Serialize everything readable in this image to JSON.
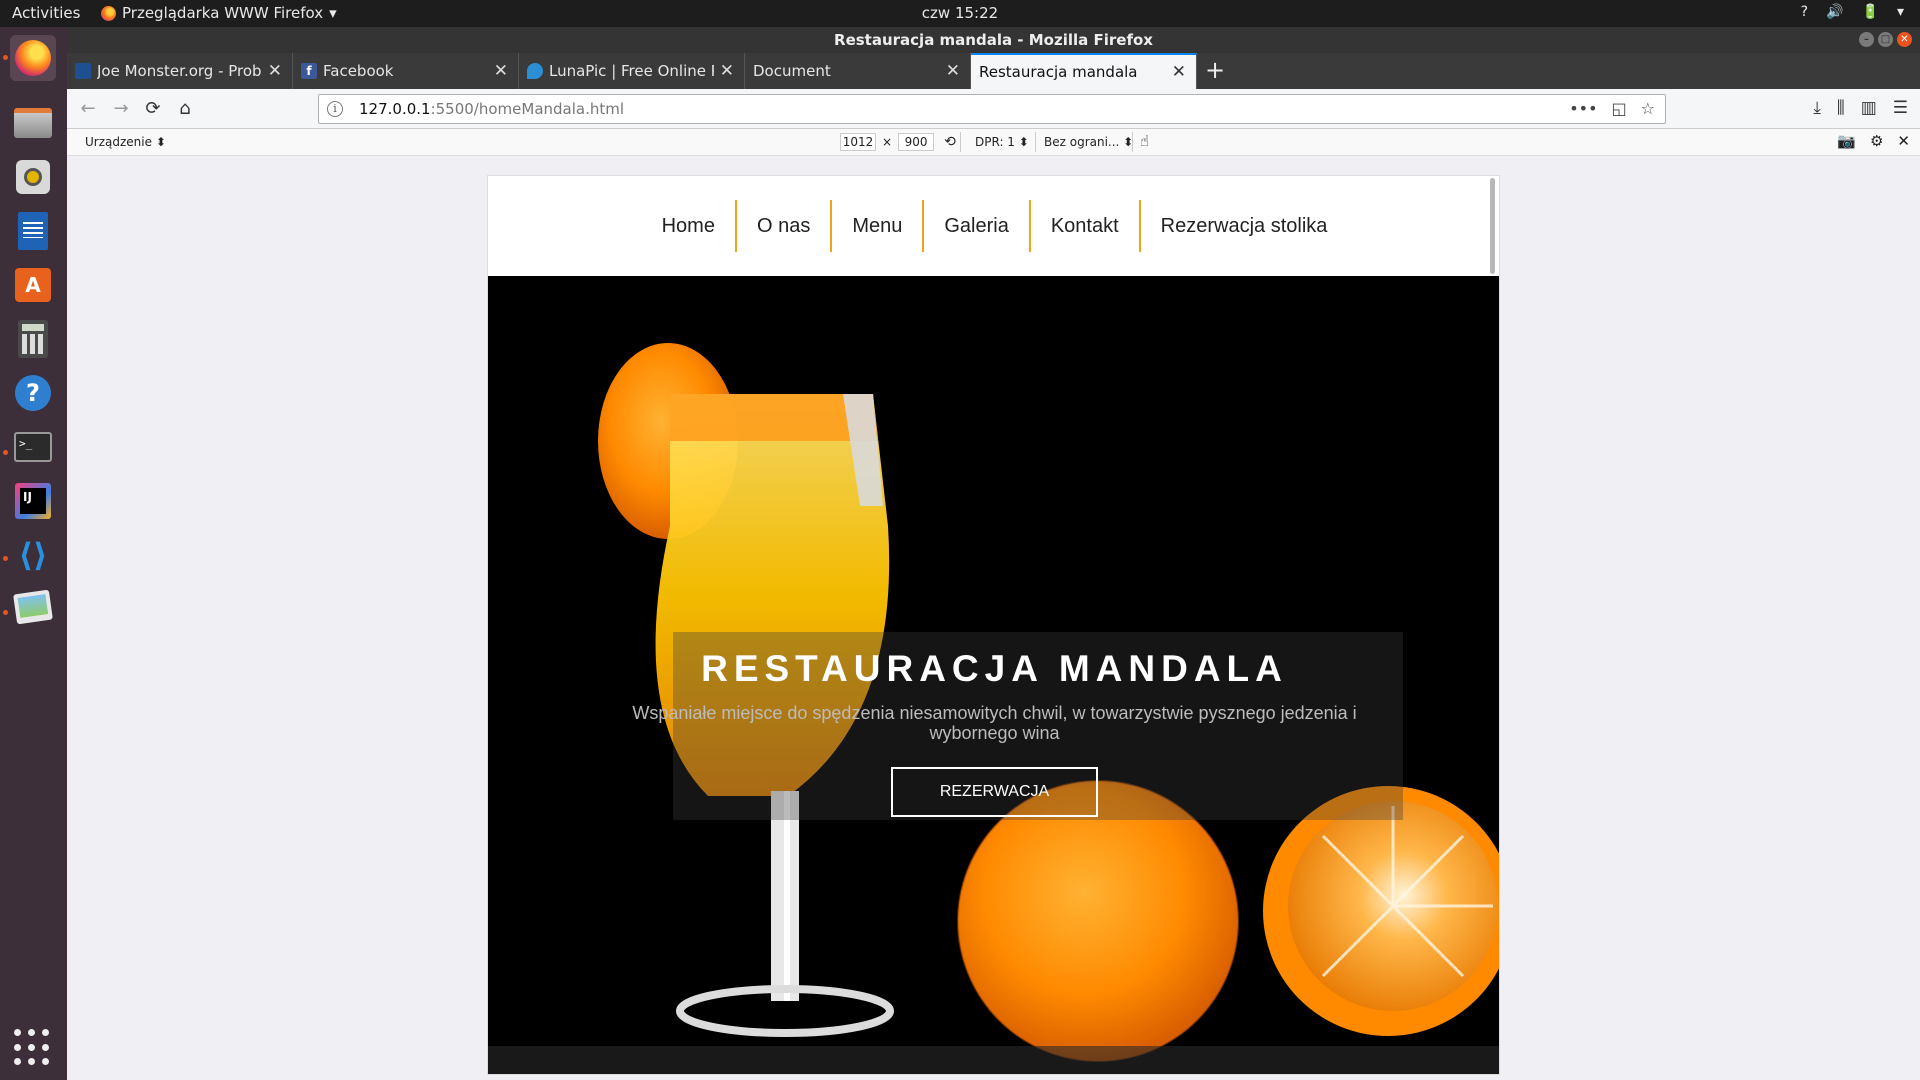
{
  "topbar": {
    "activities": "Activities",
    "app_menu": "Przeglądarka WWW Firefox",
    "clock": "czw 15:22",
    "tray": [
      "?",
      "🔊",
      "🔋",
      "▾"
    ]
  },
  "window": {
    "title": "Restauracja mandala - Mozilla Firefox"
  },
  "tabs": [
    {
      "label": "Joe Monster.org - Proba",
      "favicon_color": "#3a7bd5"
    },
    {
      "label": "Facebook",
      "favicon_color": "#3b5998"
    },
    {
      "label": "LunaPic | Free Online Ph",
      "favicon_color": "#2b8fd6"
    },
    {
      "label": "Document",
      "favicon_color": ""
    },
    {
      "label": "Restauracja mandala",
      "favicon_color": "",
      "active": true
    }
  ],
  "new_tab": "+",
  "navbar": {
    "back": "←",
    "forward": "→",
    "reload": "⟳",
    "home": "⌂",
    "url_host": "127.0.0.1",
    "url_path": ":5500/homeMandala.html",
    "url_actions": [
      "•••",
      "◱",
      "☆"
    ],
    "right_icons": [
      "⤓",
      "⫼",
      "▥",
      "☰"
    ]
  },
  "rdm": {
    "device": "Urządzenie",
    "width": "1012",
    "times": "×",
    "height": "900",
    "dpr": "DPR: 1",
    "throttle": "Bez ograni...",
    "touch": "☝",
    "right_icons": [
      "📷",
      "⚙",
      "✕"
    ]
  },
  "site": {
    "nav": [
      "Home",
      "O nas",
      "Menu",
      "Galeria",
      "Kontakt",
      "Rezerwacja stolika"
    ],
    "hero_title": "RESTAURACJA MANDALA",
    "hero_subtitle": "Wspaniałe miejsce do spędzenia niesamowitych chwil, w towarzystwie pysznego jedzenia i wybornego wina",
    "hero_button": "REZERWACJA"
  },
  "colors": {
    "accent_divider": "#f0a31c",
    "tab_active_indicator": "#0a84ff",
    "dock_bg": "#3d2f3a"
  }
}
